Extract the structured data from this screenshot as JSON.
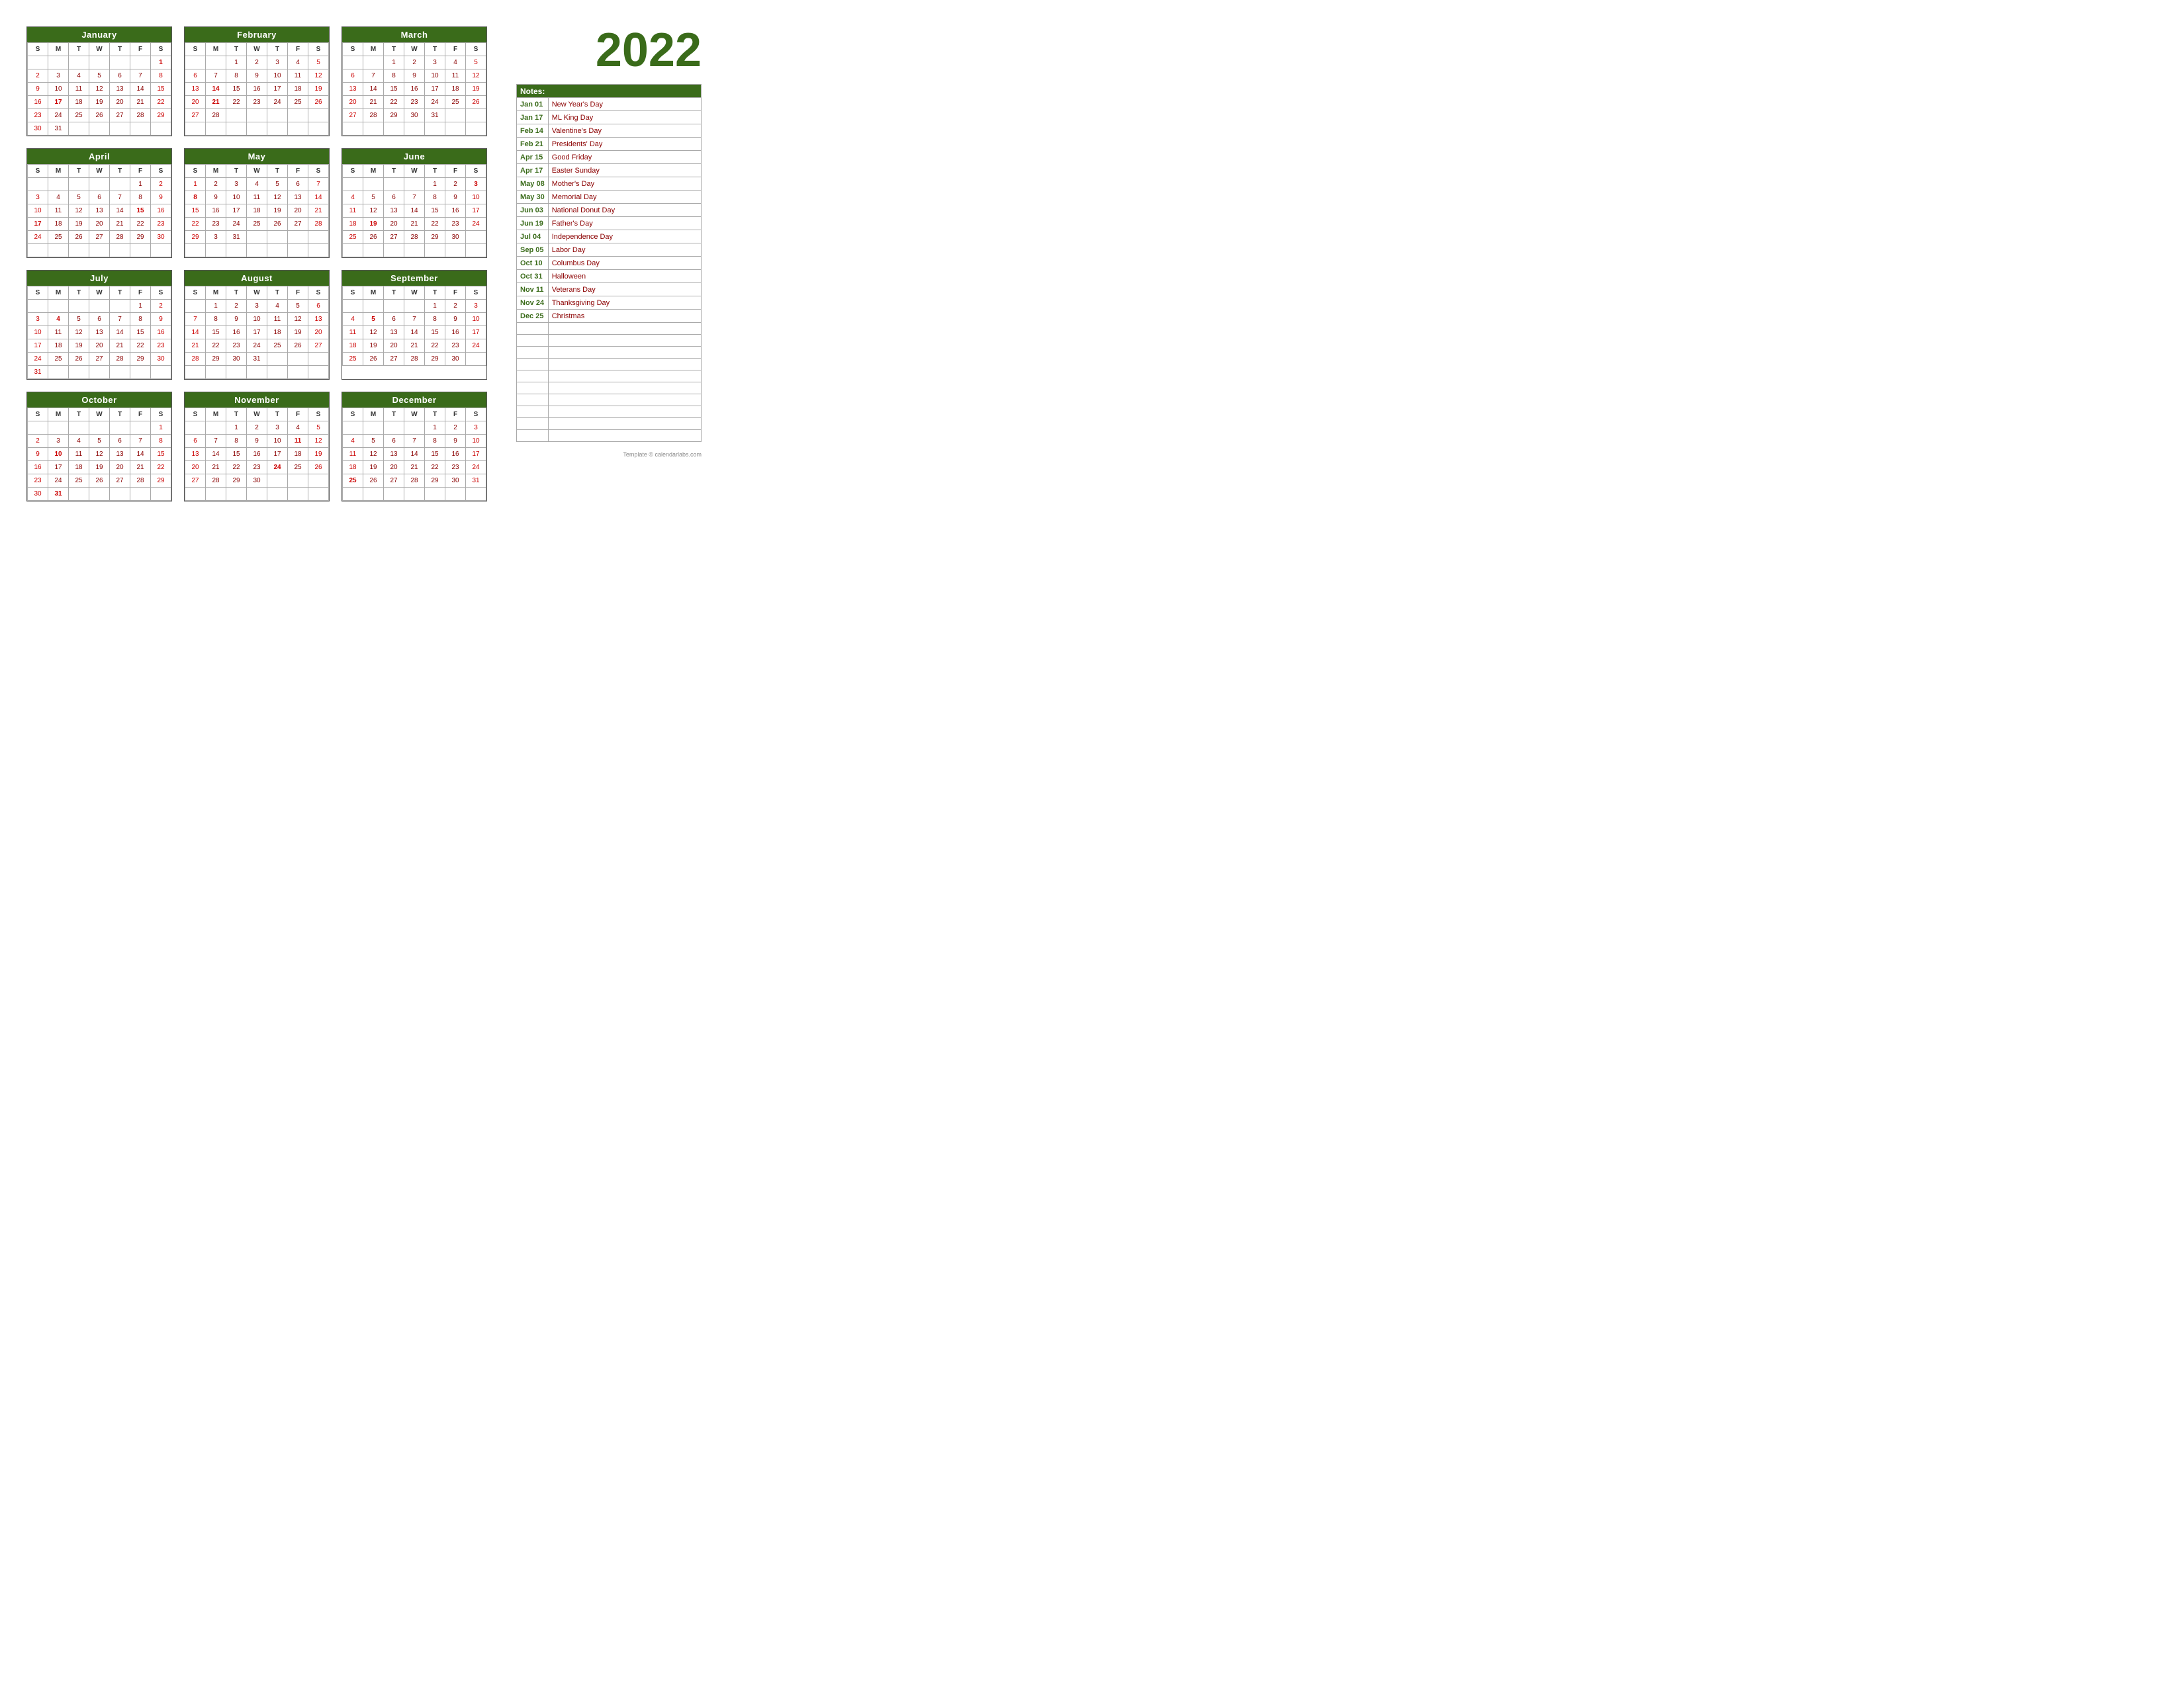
{
  "year": "2022",
  "months": [
    {
      "name": "January",
      "weeks": [
        [
          "",
          "",
          "",
          "",
          "",
          "",
          "1"
        ],
        [
          "2",
          "3",
          "4",
          "5",
          "6",
          "7",
          "8"
        ],
        [
          "9",
          "10",
          "11",
          "12",
          "13",
          "14",
          "15"
        ],
        [
          "16",
          "17",
          "18",
          "19",
          "20",
          "21",
          "22"
        ],
        [
          "23",
          "24",
          "25",
          "26",
          "27",
          "28",
          "29"
        ],
        [
          "30",
          "31",
          "",
          "",
          "",
          "",
          ""
        ]
      ],
      "holidays": [
        "1",
        "17"
      ]
    },
    {
      "name": "February",
      "weeks": [
        [
          "",
          "",
          "1",
          "2",
          "3",
          "4",
          "5"
        ],
        [
          "6",
          "7",
          "8",
          "9",
          "10",
          "11",
          "12"
        ],
        [
          "13",
          "14",
          "15",
          "16",
          "17",
          "18",
          "19"
        ],
        [
          "20",
          "21",
          "22",
          "23",
          "24",
          "25",
          "26"
        ],
        [
          "27",
          "28",
          "",
          "",
          "",
          "",
          ""
        ],
        [
          "",
          "",
          "",
          "",
          "",
          "",
          ""
        ]
      ],
      "holidays": [
        "14",
        "21"
      ]
    },
    {
      "name": "March",
      "weeks": [
        [
          "",
          "",
          "1",
          "2",
          "3",
          "4",
          "5"
        ],
        [
          "6",
          "7",
          "8",
          "9",
          "10",
          "11",
          "12"
        ],
        [
          "13",
          "14",
          "15",
          "16",
          "17",
          "18",
          "19"
        ],
        [
          "20",
          "21",
          "22",
          "23",
          "24",
          "25",
          "26"
        ],
        [
          "27",
          "28",
          "29",
          "30",
          "31",
          "",
          ""
        ],
        [
          "",
          "",
          "",
          "",
          "",
          "",
          ""
        ]
      ],
      "holidays": []
    },
    {
      "name": "April",
      "weeks": [
        [
          "",
          "",
          "",
          "",
          "",
          "1",
          "2"
        ],
        [
          "3",
          "4",
          "5",
          "6",
          "7",
          "8",
          "9"
        ],
        [
          "10",
          "11",
          "12",
          "13",
          "14",
          "15",
          "16"
        ],
        [
          "17",
          "18",
          "19",
          "20",
          "21",
          "22",
          "23"
        ],
        [
          "24",
          "25",
          "26",
          "27",
          "28",
          "29",
          "30"
        ],
        [
          "",
          "",
          "",
          "",
          "",
          "",
          ""
        ]
      ],
      "holidays": [
        "15",
        "17"
      ]
    },
    {
      "name": "May",
      "weeks": [
        [
          "1",
          "2",
          "3",
          "4",
          "5",
          "6",
          "7"
        ],
        [
          "8",
          "9",
          "10",
          "11",
          "12",
          "13",
          "14"
        ],
        [
          "15",
          "16",
          "17",
          "18",
          "19",
          "20",
          "21"
        ],
        [
          "22",
          "23",
          "24",
          "25",
          "26",
          "27",
          "28"
        ],
        [
          "29",
          "3",
          "31",
          "",
          "",
          "",
          ""
        ],
        [
          "",
          "",
          "",
          "",
          "",
          "",
          ""
        ]
      ],
      "holidays": [
        "8",
        "30"
      ]
    },
    {
      "name": "June",
      "weeks": [
        [
          "",
          "",
          "",
          "",
          "1",
          "2",
          "3"
        ],
        [
          "4",
          "5",
          "6",
          "7",
          "8",
          "9",
          "10"
        ],
        [
          "11",
          "12",
          "13",
          "14",
          "15",
          "16",
          "17"
        ],
        [
          "18",
          "19",
          "20",
          "21",
          "22",
          "23",
          "24"
        ],
        [
          "25",
          "26",
          "27",
          "28",
          "29",
          "30",
          ""
        ],
        [
          "",
          "",
          "",
          "",
          "",
          "",
          ""
        ]
      ],
      "holidays": [
        "3",
        "19"
      ]
    },
    {
      "name": "July",
      "weeks": [
        [
          "",
          "",
          "",
          "",
          "",
          "1",
          "2"
        ],
        [
          "3",
          "4",
          "5",
          "6",
          "7",
          "8",
          "9"
        ],
        [
          "10",
          "11",
          "12",
          "13",
          "14",
          "15",
          "16"
        ],
        [
          "17",
          "18",
          "19",
          "20",
          "21",
          "22",
          "23"
        ],
        [
          "24",
          "25",
          "26",
          "27",
          "28",
          "29",
          "30"
        ],
        [
          "31",
          "",
          "",
          "",
          "",
          "",
          ""
        ]
      ],
      "holidays": [
        "4"
      ]
    },
    {
      "name": "August",
      "weeks": [
        [
          "",
          "1",
          "2",
          "3",
          "4",
          "5",
          "6"
        ],
        [
          "7",
          "8",
          "9",
          "10",
          "11",
          "12",
          "13"
        ],
        [
          "14",
          "15",
          "16",
          "17",
          "18",
          "19",
          "20"
        ],
        [
          "21",
          "22",
          "23",
          "24",
          "25",
          "26",
          "27"
        ],
        [
          "28",
          "29",
          "30",
          "31",
          "",
          "",
          ""
        ],
        [
          "",
          "",
          "",
          "",
          "",
          "",
          ""
        ]
      ],
      "holidays": []
    },
    {
      "name": "September",
      "weeks": [
        [
          "S",
          "M",
          "T",
          "W",
          "T",
          "F",
          "S"
        ],
        [
          "",
          "",
          "",
          "",
          "1",
          "2",
          "3"
        ],
        [
          "4",
          "5",
          "6",
          "7",
          "8",
          "9",
          "10"
        ],
        [
          "11",
          "12",
          "13",
          "14",
          "15",
          "16",
          "17"
        ],
        [
          "18",
          "19",
          "20",
          "21",
          "22",
          "23",
          "24"
        ],
        [
          "25",
          "26",
          "27",
          "28",
          "29",
          "30",
          ""
        ]
      ],
      "holidays": [
        "5"
      ]
    },
    {
      "name": "October",
      "weeks": [
        [
          "",
          "",
          "",
          "",
          "",
          "",
          "1"
        ],
        [
          "2",
          "3",
          "4",
          "5",
          "6",
          "7",
          "8"
        ],
        [
          "9",
          "10",
          "11",
          "12",
          "13",
          "14",
          "15"
        ],
        [
          "16",
          "17",
          "18",
          "19",
          "20",
          "21",
          "22"
        ],
        [
          "23",
          "24",
          "25",
          "26",
          "27",
          "28",
          "29"
        ],
        [
          "30",
          "31",
          "",
          "",
          "",
          "",
          ""
        ]
      ],
      "holidays": [
        "10",
        "31"
      ]
    },
    {
      "name": "November",
      "weeks": [
        [
          "",
          "",
          "1",
          "2",
          "3",
          "4",
          "5"
        ],
        [
          "6",
          "7",
          "8",
          "9",
          "10",
          "11",
          "12"
        ],
        [
          "13",
          "14",
          "15",
          "16",
          "17",
          "18",
          "19"
        ],
        [
          "20",
          "21",
          "22",
          "23",
          "24",
          "25",
          "26"
        ],
        [
          "27",
          "28",
          "29",
          "30",
          "",
          "",
          ""
        ],
        [
          "",
          "",
          "",
          "",
          "",
          "",
          ""
        ]
      ],
      "holidays": [
        "11",
        "24"
      ]
    },
    {
      "name": "December",
      "weeks": [
        [
          "",
          "",
          "",
          "",
          "1",
          "2",
          "3"
        ],
        [
          "4",
          "5",
          "6",
          "7",
          "8",
          "9",
          "10"
        ],
        [
          "11",
          "12",
          "13",
          "14",
          "15",
          "16",
          "17"
        ],
        [
          "18",
          "19",
          "20",
          "21",
          "22",
          "23",
          "24"
        ],
        [
          "25",
          "26",
          "27",
          "28",
          "29",
          "30",
          "31"
        ],
        [
          "",
          "",
          "",
          "",
          "",
          "",
          ""
        ]
      ],
      "holidays": [
        "25"
      ]
    }
  ],
  "notes": {
    "header": "Notes:",
    "holidays": [
      {
        "date": "Jan 01",
        "name": "New Year's Day"
      },
      {
        "date": "Jan 17",
        "name": "ML King Day"
      },
      {
        "date": "Feb 14",
        "name": "Valentine's Day"
      },
      {
        "date": "Feb 21",
        "name": "Presidents' Day"
      },
      {
        "date": "Apr 15",
        "name": "Good Friday"
      },
      {
        "date": "Apr 17",
        "name": "Easter Sunday"
      },
      {
        "date": "May 08",
        "name": "Mother's Day"
      },
      {
        "date": "May 30",
        "name": "Memorial Day"
      },
      {
        "date": "Jun 03",
        "name": "National Donut Day"
      },
      {
        "date": "Jun 19",
        "name": "Father's Day"
      },
      {
        "date": "Jul 04",
        "name": "Independence Day"
      },
      {
        "date": "Sep 05",
        "name": "Labor Day"
      },
      {
        "date": "Oct 10",
        "name": "Columbus Day"
      },
      {
        "date": "Oct 31",
        "name": "Halloween"
      },
      {
        "date": "Nov 11",
        "name": "Veterans Day"
      },
      {
        "date": "Nov 24",
        "name": "Thanksgiving Day"
      },
      {
        "date": "Dec 25",
        "name": "Christmas"
      }
    ]
  },
  "credit": "Template © calendarlabs.com"
}
